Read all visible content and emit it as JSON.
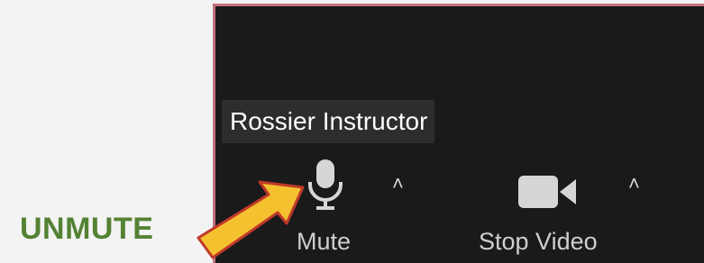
{
  "annotation": {
    "label": "UNMUTE",
    "label_color": "#548234",
    "arrow_fill": "#f5c12e",
    "arrow_outline": "#c0392b"
  },
  "zoom": {
    "participant_name": "Rossier Instructor",
    "toolbar": {
      "mute_label": "Mute",
      "mute_icon": "microphone-icon",
      "stop_video_label": "Stop Video",
      "video_icon": "video-camera-icon",
      "caret_icon": "chevron-up-icon"
    },
    "panel_background": "#1a1a1a",
    "panel_border": "#c3727e"
  }
}
